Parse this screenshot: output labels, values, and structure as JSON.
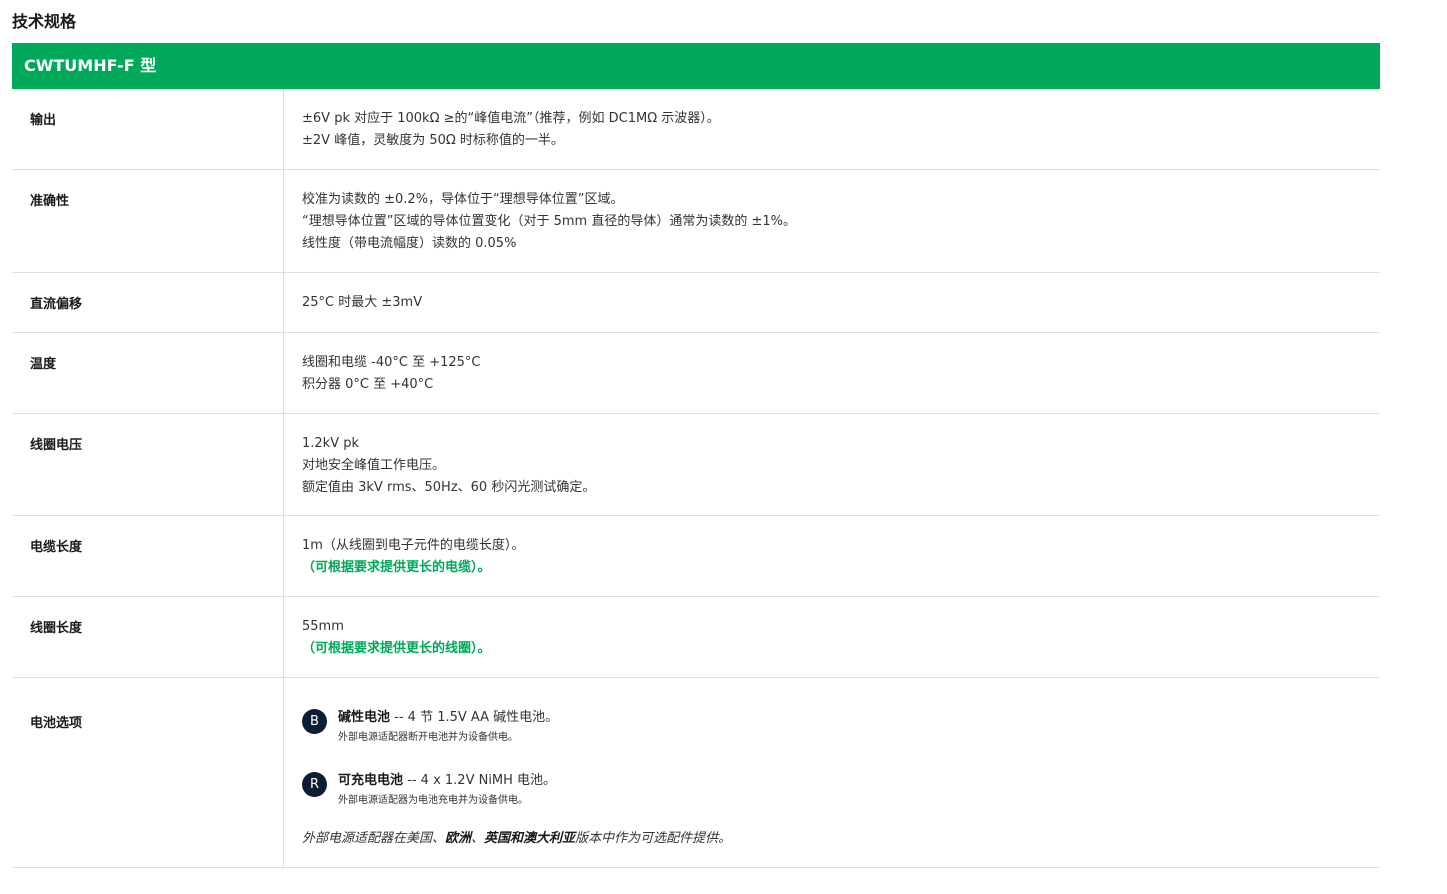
{
  "title": "技术规格",
  "header": "CWTUMHF-F 型",
  "colors": {
    "accent": "#00a85a",
    "badge": "#0b1e36",
    "border": "#dedede"
  },
  "rows": [
    {
      "label": "输出",
      "lines": [
        "±6V pk 对应于 100kΩ ≥的“峰值电流”（推荐，例如 DC1MΩ 示波器）。",
        "±2V 峰值，灵敏度为 50Ω 时标称值的一半。"
      ]
    },
    {
      "label": "准确性",
      "lines": [
        "校准为读数的 ±0.2%，导体位于“理想导体位置”区域。",
        "“理想导体位置”区域的导体位置变化（对于 5mm 直径的导体）通常为读数的 ±1%。",
        "线性度（带电流幅度）读数的 0.05%"
      ]
    },
    {
      "label": "直流偏移",
      "lines": [
        "25°C 时最大 ±3mV"
      ]
    },
    {
      "label": "温度",
      "lines": [
        "线圈和电缆 -40°C 至 +125°C",
        "积分器 0°C 至 +40°C"
      ]
    },
    {
      "label": "线圈电压",
      "lines": [
        "1.2kV pk",
        "对地安全峰值工作电压。",
        "额定值由 3kV rms、50Hz、60 秒闪光测试确定。"
      ]
    },
    {
      "label": "电缆长度",
      "lines": [
        "1m（从线圈到电子元件的电缆长度）。"
      ],
      "highlight": "（可根据要求提供更长的电缆）。"
    },
    {
      "label": "线圈长度",
      "lines": [
        "55mm"
      ],
      "highlight": "（可根据要求提供更长的线圈）。"
    },
    {
      "label": "电池选项"
    }
  ],
  "battery": {
    "items": [
      {
        "badge": "B",
        "name": "碱性电池",
        "desc": " -- 4 节 1.5V AA 碱性电池。",
        "sub": "外部电源适配器断开电池并为设备供电。"
      },
      {
        "badge": "R",
        "name": "可充电电池",
        "desc": " -- 4 x 1.2V NiMH 电池。",
        "sub": "外部电源适配器为电池充电并为设备供电。"
      }
    ],
    "note_pre": "外部电源适配器在美国、",
    "note_b1": "欧洲",
    "note_mid": "、",
    "note_b2": "英国和澳大利亚",
    "note_post": "版本中作为可选配件提供。"
  }
}
